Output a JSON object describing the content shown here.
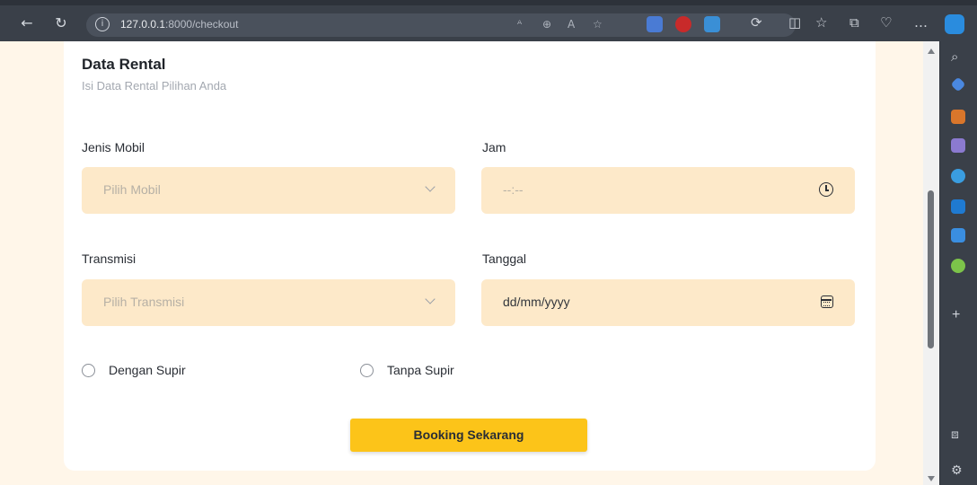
{
  "browser": {
    "url_host": "127.0.0.1",
    "url_port_path": ":8000/checkout",
    "back_icon": "arrow-left-icon",
    "refresh_icon": "refresh-icon",
    "more_icon": "ellipsis-icon"
  },
  "form": {
    "title": "Data Rental",
    "subtitle": "Isi Data Rental Pilihan Anda",
    "car_type": {
      "label": "Jenis Mobil",
      "placeholder": "Pilih Mobil"
    },
    "time": {
      "label": "Jam",
      "placeholder": "--:--"
    },
    "transmission": {
      "label": "Transmisi",
      "placeholder": "Pilih Transmisi"
    },
    "date": {
      "label": "Tanggal",
      "value": "dd/mm/yyyy"
    },
    "driver_options": [
      "Dengan Supir",
      "Tanpa Supir"
    ],
    "submit_label": "Booking Sekarang"
  },
  "colors": {
    "accent": "#fcc419",
    "field_bg": "#fde9c9",
    "page_bg": "#fff6e9"
  }
}
